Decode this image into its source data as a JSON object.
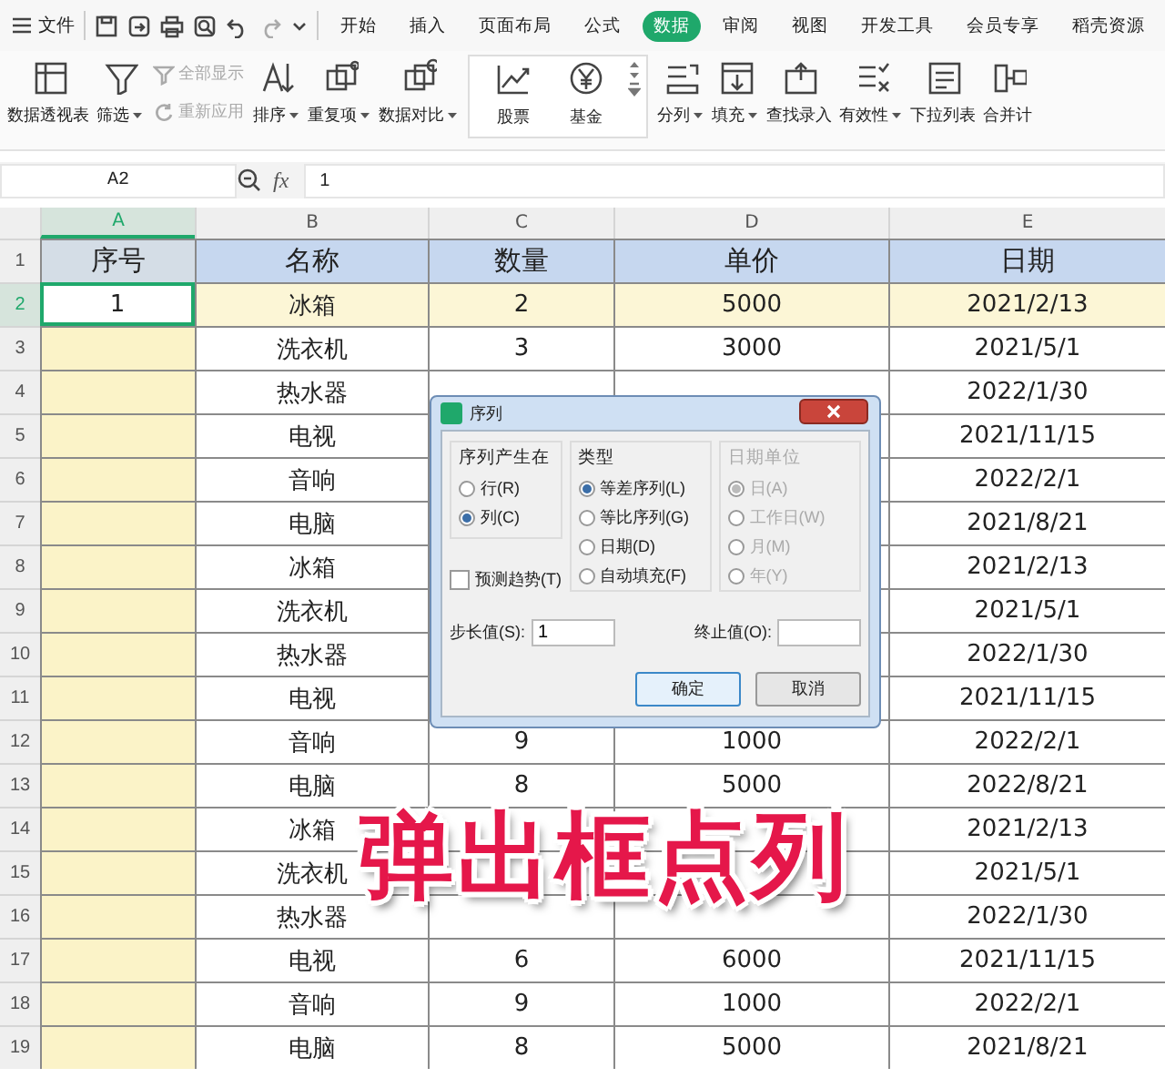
{
  "menu": {
    "file": "文件",
    "tabs": [
      {
        "label": "开始",
        "selected": false
      },
      {
        "label": "插入",
        "selected": false
      },
      {
        "label": "页面布局",
        "selected": false
      },
      {
        "label": "公式",
        "selected": false
      },
      {
        "label": "数据",
        "selected": true
      },
      {
        "label": "审阅",
        "selected": false
      },
      {
        "label": "视图",
        "selected": false
      },
      {
        "label": "开发工具",
        "selected": false
      },
      {
        "label": "会员专享",
        "selected": false
      },
      {
        "label": "稻壳资源",
        "selected": false
      }
    ]
  },
  "ribbon": [
    {
      "kind": "big",
      "label": "数据透视表",
      "caret": false
    },
    {
      "kind": "big",
      "label": "筛选",
      "caret": true
    },
    {
      "kind": "stack",
      "items": [
        {
          "label": "全部显示",
          "disabled": true
        },
        {
          "label": "重新应用",
          "disabled": true
        }
      ]
    },
    {
      "kind": "big",
      "label": "排序",
      "caret": true
    },
    {
      "kind": "big",
      "label": "重复项",
      "caret": true
    },
    {
      "kind": "big",
      "label": "数据对比",
      "caret": true
    },
    {
      "kind": "gallery",
      "items": [
        "股票",
        "基金"
      ]
    },
    {
      "kind": "big",
      "label": "分列",
      "caret": true
    },
    {
      "kind": "big",
      "label": "填充",
      "caret": true
    },
    {
      "kind": "big",
      "label": "查找录入",
      "caret": false
    },
    {
      "kind": "big",
      "label": "有效性",
      "caret": true
    },
    {
      "kind": "big",
      "label": "下拉列表",
      "caret": false
    },
    {
      "kind": "big",
      "label": "合并计",
      "caret": false
    }
  ],
  "formula_bar": {
    "name_box": "A2",
    "fx": "fx",
    "value": "1"
  },
  "table": {
    "columns": [
      {
        "label": "A",
        "selected": true
      },
      {
        "label": "B",
        "selected": false
      },
      {
        "label": "C",
        "selected": false
      },
      {
        "label": "D",
        "selected": false
      },
      {
        "label": "E",
        "selected": false
      }
    ],
    "header": {
      "number": "1",
      "cells": [
        "序号",
        "名称",
        "数量",
        "单价",
        "日期"
      ]
    },
    "rows": [
      {
        "number": "2",
        "selected": true,
        "cells": [
          "1",
          "冰箱",
          "2",
          "5000",
          "2021/2/13"
        ]
      },
      {
        "number": "3",
        "selected": false,
        "cells": [
          null,
          "洗衣机",
          "3",
          "3000",
          "2021/5/1"
        ]
      },
      {
        "number": "4",
        "selected": false,
        "cells": [
          null,
          "热水器",
          null,
          null,
          "2022/1/30"
        ]
      },
      {
        "number": "5",
        "selected": false,
        "cells": [
          null,
          "电视",
          null,
          null,
          "2021/11/15"
        ]
      },
      {
        "number": "6",
        "selected": false,
        "cells": [
          null,
          "音响",
          null,
          null,
          "2022/2/1"
        ]
      },
      {
        "number": "7",
        "selected": false,
        "cells": [
          null,
          "电脑",
          null,
          null,
          "2021/8/21"
        ]
      },
      {
        "number": "8",
        "selected": false,
        "cells": [
          null,
          "冰箱",
          null,
          null,
          "2021/2/13"
        ]
      },
      {
        "number": "9",
        "selected": false,
        "cells": [
          null,
          "洗衣机",
          null,
          null,
          "2021/5/1"
        ]
      },
      {
        "number": "10",
        "selected": false,
        "cells": [
          null,
          "热水器",
          null,
          null,
          "2022/1/30"
        ]
      },
      {
        "number": "11",
        "selected": false,
        "cells": [
          null,
          "电视",
          null,
          null,
          "2021/11/15"
        ]
      },
      {
        "number": "12",
        "selected": false,
        "cells": [
          null,
          "音响",
          "9",
          "1000",
          "2022/2/1"
        ]
      },
      {
        "number": "13",
        "selected": false,
        "cells": [
          null,
          "电脑",
          "8",
          "5000",
          "2022/8/21"
        ]
      },
      {
        "number": "14",
        "selected": false,
        "cells": [
          null,
          "冰箱",
          null,
          null,
          "2021/2/13"
        ]
      },
      {
        "number": "15",
        "selected": false,
        "cells": [
          null,
          "洗衣机",
          null,
          null,
          "2021/5/1"
        ]
      },
      {
        "number": "16",
        "selected": false,
        "cells": [
          null,
          "热水器",
          null,
          null,
          "2022/1/30"
        ]
      },
      {
        "number": "17",
        "selected": false,
        "cells": [
          null,
          "电视",
          "6",
          "6000",
          "2021/11/15"
        ]
      },
      {
        "number": "18",
        "selected": false,
        "cells": [
          null,
          "音响",
          "9",
          "1000",
          "2022/2/1"
        ]
      },
      {
        "number": "19",
        "selected": false,
        "cells": [
          null,
          "电脑",
          "8",
          "5000",
          "2021/8/21"
        ]
      }
    ]
  },
  "dialog": {
    "title": "序列",
    "groups": [
      {
        "title": "序列产生在",
        "disabled": false,
        "options": [
          {
            "label": "行(R)",
            "selected": false
          },
          {
            "label": "列(C)",
            "selected": true
          }
        ]
      },
      {
        "title": "类型",
        "disabled": false,
        "options": [
          {
            "label": "等差序列(L)",
            "selected": true
          },
          {
            "label": "等比序列(G)",
            "selected": false
          },
          {
            "label": "日期(D)",
            "selected": false
          },
          {
            "label": "自动填充(F)",
            "selected": false
          }
        ]
      },
      {
        "title": "日期单位",
        "disabled": true,
        "options": [
          {
            "label": "日(A)",
            "selected": true
          },
          {
            "label": "工作日(W)",
            "selected": false
          },
          {
            "label": "月(M)",
            "selected": false
          },
          {
            "label": "年(Y)",
            "selected": false
          }
        ]
      }
    ],
    "checkbox": {
      "label": "预测趋势(T)",
      "checked": false
    },
    "step": {
      "label": "步长值(S):",
      "value": "1"
    },
    "stop": {
      "label": "终止值(O):"
    },
    "buttons": [
      "确定",
      "取消"
    ]
  },
  "caption": "弹出框点列"
}
